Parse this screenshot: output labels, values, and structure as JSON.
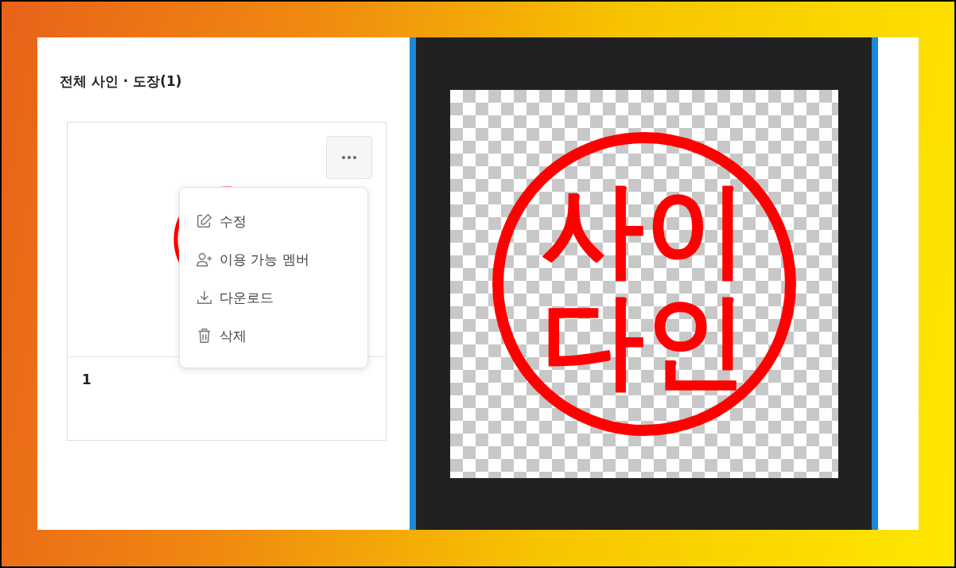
{
  "title": "전체 사인 · 도장(1)",
  "card": {
    "name": "1",
    "menu_open": true,
    "menu": [
      {
        "kind": "edit",
        "label": "수정"
      },
      {
        "kind": "members",
        "label": "이용 가능 멤버"
      },
      {
        "kind": "download",
        "label": "다운로드"
      },
      {
        "kind": "delete",
        "label": "삭제"
      }
    ]
  },
  "preview": {
    "stamp_lines": [
      "사이",
      "다인"
    ]
  }
}
